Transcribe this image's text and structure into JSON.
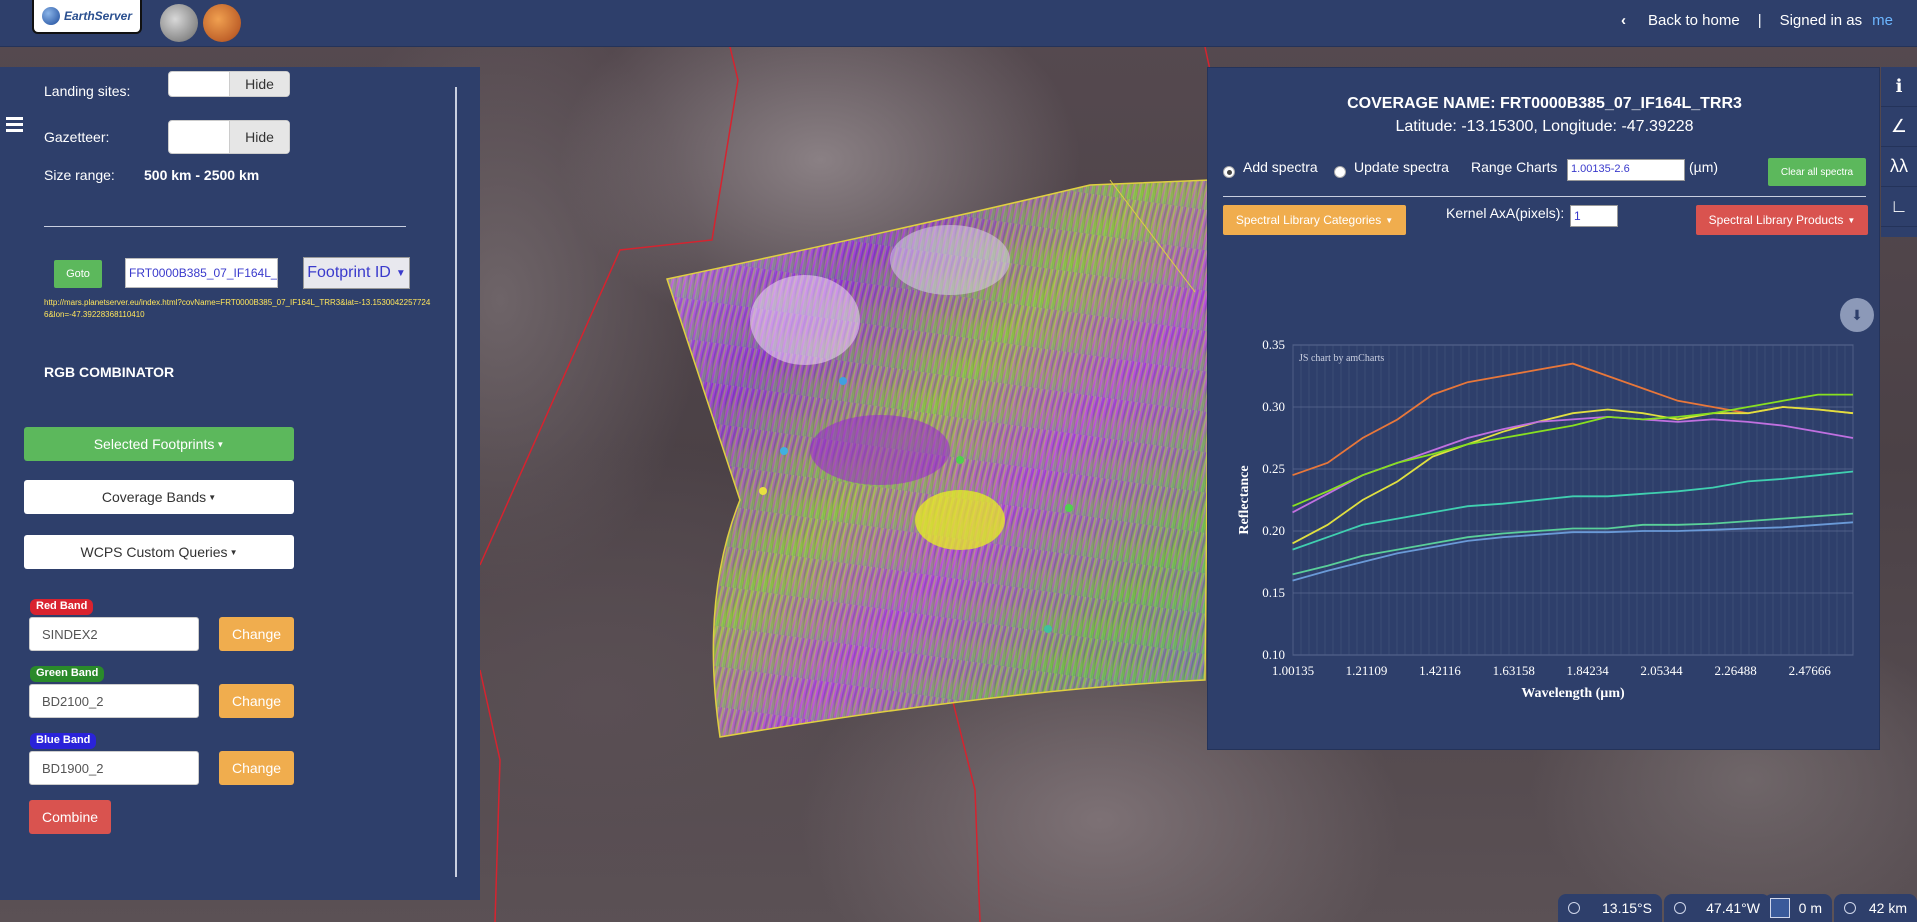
{
  "topbar": {
    "logo_text": "EarthServer",
    "back_label": "Back to home",
    "separator": "|",
    "signed_in_label": "Signed in as",
    "user": "me"
  },
  "left_panel": {
    "landing_sites_label": "Landing sites:",
    "gazetteer_label": "Gazetteer:",
    "hide_label": "Hide",
    "size_range_label": "Size range:",
    "size_range_value": "500 km - 2500 km",
    "goto_label": "Goto",
    "coverage_input": "FRT0000B385_07_IF164L_TRR3",
    "footprint_select": "Footprint ID",
    "link_text": "http://mars.planetserver.eu/index.html?covName=FRT0000B385_07_IF164L_TRR3&lat=-13.15300422577246&lon=-47.39228368110410",
    "rgb_title": "RGB COMBINATOR",
    "selected_footprints": "Selected Footprints",
    "coverage_bands": "Coverage Bands",
    "wcps_queries": "WCPS Custom Queries",
    "bands": [
      {
        "badge": "Red Band",
        "value": "SINDEX2",
        "color": "#d9232f"
      },
      {
        "badge": "Green Band",
        "value": "BD2100_2",
        "color": "#2a8a2a"
      },
      {
        "badge": "Blue Band",
        "value": "BD1900_2",
        "color": "#2a23d9"
      }
    ],
    "change_label": "Change",
    "combine_label": "Combine"
  },
  "right_panel": {
    "coverage_name": "COVERAGE NAME: FRT0000B385_07_IF164L_TRR3",
    "latlon": "Latitude: -13.15300, Longitude: -47.39228",
    "add_spectra": "Add spectra",
    "update_spectra": "Update spectra",
    "range_charts_label": "Range Charts",
    "range_value": "1.00135-2.6",
    "range_unit": "(µm)",
    "clear_all": "Clear all spectra",
    "spectral_categories": "Spectral Library Categories",
    "kernel_label": "Kernel AxA(pixels):",
    "kernel_value": "1",
    "spectral_products": "Spectral Library Products"
  },
  "chart_data": {
    "type": "line",
    "credit": "JS chart by amCharts",
    "xlabel": "Wavelength (µm)",
    "ylabel": "Reflectance",
    "x_tick_labels": [
      "1.00135",
      "1.21109",
      "1.42116",
      "1.63158",
      "1.84234",
      "2.05344",
      "2.26488",
      "2.47666"
    ],
    "xlim": [
      1.00135,
      2.6
    ],
    "y_tick_labels": [
      "0.10",
      "0.15",
      "0.20",
      "0.25",
      "0.30",
      "0.35"
    ],
    "ylim": [
      0.1,
      0.35
    ],
    "x": [
      1.0,
      1.1,
      1.2,
      1.3,
      1.4,
      1.5,
      1.6,
      1.7,
      1.8,
      1.9,
      2.0,
      2.1,
      2.2,
      2.3,
      2.4,
      2.5,
      2.6
    ],
    "series": [
      {
        "color": "#e8773a",
        "values": [
          0.245,
          0.255,
          0.275,
          0.29,
          0.31,
          0.32,
          0.325,
          0.33,
          0.335,
          0.325,
          0.315,
          0.305,
          0.3,
          0.295,
          0.3,
          0.298,
          0.295
        ]
      },
      {
        "color": "#e0e040",
        "values": [
          0.19,
          0.205,
          0.225,
          0.24,
          0.26,
          0.27,
          0.28,
          0.288,
          0.295,
          0.298,
          0.295,
          0.29,
          0.295,
          0.295,
          0.3,
          0.298,
          0.295
        ]
      },
      {
        "color": "#c070e0",
        "values": [
          0.215,
          0.23,
          0.245,
          0.255,
          0.265,
          0.275,
          0.282,
          0.288,
          0.29,
          0.292,
          0.29,
          0.288,
          0.29,
          0.288,
          0.285,
          0.28,
          0.275
        ]
      },
      {
        "color": "#88e020",
        "values": [
          0.22,
          0.232,
          0.245,
          0.255,
          0.262,
          0.27,
          0.275,
          0.28,
          0.285,
          0.292,
          0.29,
          0.292,
          0.295,
          0.3,
          0.305,
          0.31,
          0.31
        ]
      },
      {
        "color": "#40d0b0",
        "values": [
          0.185,
          0.195,
          0.205,
          0.21,
          0.215,
          0.22,
          0.222,
          0.225,
          0.228,
          0.228,
          0.23,
          0.232,
          0.235,
          0.24,
          0.242,
          0.245,
          0.248
        ]
      },
      {
        "color": "#5ad09a",
        "values": [
          0.165,
          0.172,
          0.18,
          0.185,
          0.19,
          0.195,
          0.198,
          0.2,
          0.202,
          0.202,
          0.205,
          0.205,
          0.206,
          0.208,
          0.21,
          0.212,
          0.214
        ]
      },
      {
        "color": "#6a9ad8",
        "values": [
          0.16,
          0.168,
          0.175,
          0.182,
          0.187,
          0.192,
          0.195,
          0.197,
          0.199,
          0.199,
          0.2,
          0.2,
          0.201,
          0.202,
          0.203,
          0.205,
          0.207
        ]
      }
    ]
  },
  "statusbar": {
    "lat": "13.15°S",
    "lon": "47.41°W",
    "elev": "0 m",
    "alt": "42 km"
  }
}
